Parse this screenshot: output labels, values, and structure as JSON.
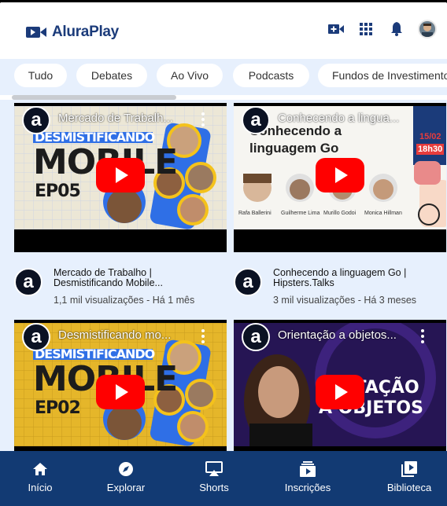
{
  "app": {
    "name": "AluraPlay"
  },
  "header": {
    "icons": [
      "video-add-icon",
      "apps-grid-icon",
      "bell-icon",
      "user-avatar"
    ]
  },
  "chips": [
    "Tudo",
    "Debates",
    "Ao Vivo",
    "Podcasts",
    "Fundos de Investimento"
  ],
  "videos": [
    {
      "thumb_title": "Mercado de Trabalh...",
      "title": "Mercado de Trabalho | Desmistificando Mobile...",
      "views": "1,1 mil visualizações",
      "age": "Há 1 mês",
      "thumb_lines": [
        "DESMISTIFICANDO",
        "MOBILE",
        "EP05"
      ]
    },
    {
      "thumb_title": "Conhecendo a lingua...",
      "title": "Conhecendo a linguagem Go | Hipsters.Talks",
      "views": "3 mil visualizações",
      "age": "Há 3 meses",
      "thumb_lines": [
        "Conhecendo a",
        "linguagem Go",
        "15/02",
        "18h30"
      ],
      "speakers": [
        "Rafa Ballerini",
        "Guilherme Lima",
        "Murillo Godoi",
        "Monica Hillman"
      ]
    },
    {
      "thumb_title": "Desmistificando mo...",
      "title": "",
      "views": "",
      "age": "",
      "thumb_lines": [
        "DESMISTIFICANDO",
        "MOBILE",
        "EP02"
      ]
    },
    {
      "thumb_title": "Orientação a objetos...",
      "title": "",
      "views": "",
      "age": "",
      "thumb_lines": [
        "ENTAÇÃO",
        "A OBJETOS"
      ]
    }
  ],
  "nav": [
    {
      "label": "Início",
      "icon": "home-icon"
    },
    {
      "label": "Explorar",
      "icon": "compass-icon"
    },
    {
      "label": "Shorts",
      "icon": "airplay-icon"
    },
    {
      "label": "Inscrições",
      "icon": "subscriptions-icon"
    },
    {
      "label": "Biblioteca",
      "icon": "library-icon"
    }
  ],
  "colors": {
    "brand": "#1b3b7a",
    "nav_bg": "#123a73",
    "chip_bar": "#e7f0fd",
    "play": "#ff0000"
  }
}
